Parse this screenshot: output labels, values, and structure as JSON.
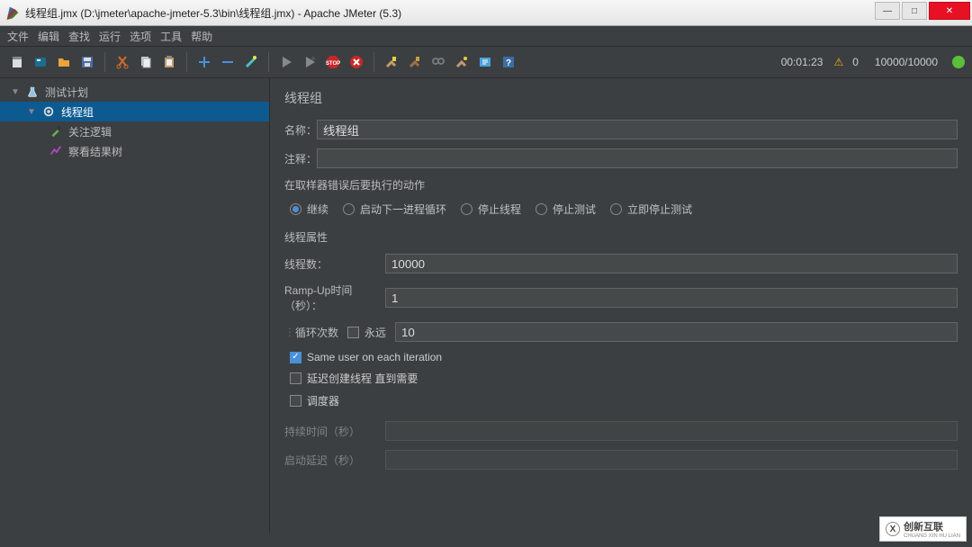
{
  "window": {
    "title": "线程组.jmx (D:\\jmeter\\apache-jmeter-5.3\\bin\\线程组.jmx) - Apache JMeter (5.3)"
  },
  "menus": [
    "文件",
    "编辑",
    "查找",
    "运行",
    "选项",
    "工具",
    "帮助"
  ],
  "status": {
    "time": "00:01:23",
    "errors": "0",
    "ratio": "10000/10000"
  },
  "tree": {
    "root": "测试计划",
    "threadGroup": "线程组",
    "children": [
      "关注逻辑",
      "察看结果树"
    ]
  },
  "form": {
    "heading": "线程组",
    "name_label": "名称：",
    "name_value": "线程组",
    "comment_label": "注释：",
    "comment_value": "",
    "onerror_label": "在取样器错误后要执行的动作",
    "onerror_options": [
      "继续",
      "启动下一进程循环",
      "停止线程",
      "停止测试",
      "立即停止测试"
    ],
    "props_label": "线程属性",
    "threads_label": "线程数：",
    "threads_value": "10000",
    "rampup_label": "Ramp-Up时间（秒）：",
    "rampup_value": "1",
    "loops_label": "循环次数",
    "forever_label": "永远",
    "loops_value": "10",
    "same_user_label": "Same user on each iteration",
    "delay_create_label": "延迟创建线程 直到需要",
    "scheduler_label": "调度器",
    "duration_label": "持续时间（秒）",
    "delay_label": "启动延迟（秒）"
  },
  "watermark": {
    "brand": "创新互联",
    "sub": "CHUANG XIN HU LIAN"
  }
}
